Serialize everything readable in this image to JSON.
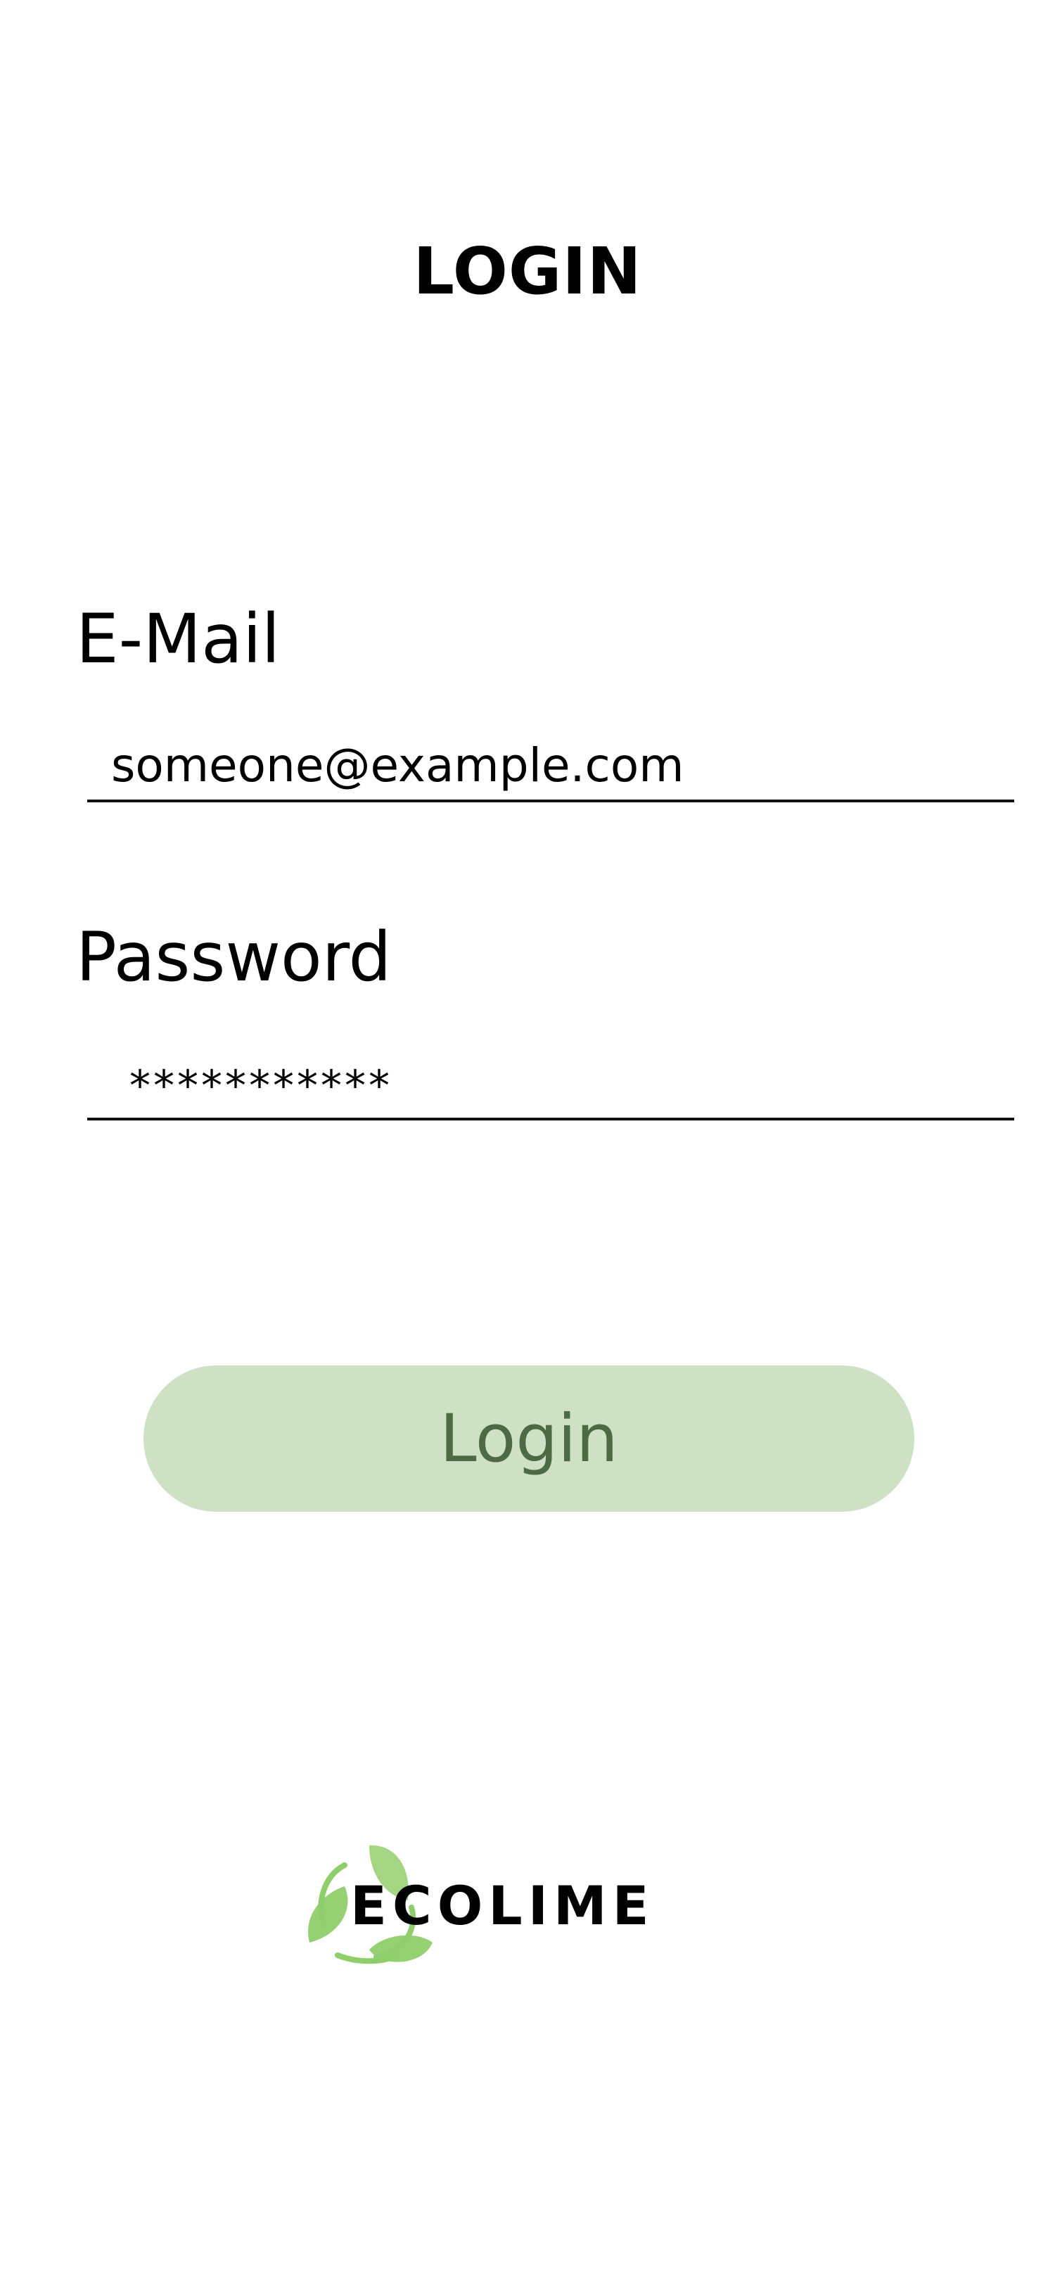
{
  "page": {
    "title": "LOGIN"
  },
  "form": {
    "email_label": "E-Mail",
    "email_value": "someone@example.com",
    "password_label": "Password",
    "password_value": "***********",
    "submit_label": "Login"
  },
  "brand": {
    "logo_text": "ECOLIME",
    "icon": "leaf-recycle-icon",
    "accent_color": "#8fce6a"
  },
  "colors": {
    "button_bg": "#cfe1c5",
    "button_text": "#4e6a45",
    "text": "#000000"
  }
}
